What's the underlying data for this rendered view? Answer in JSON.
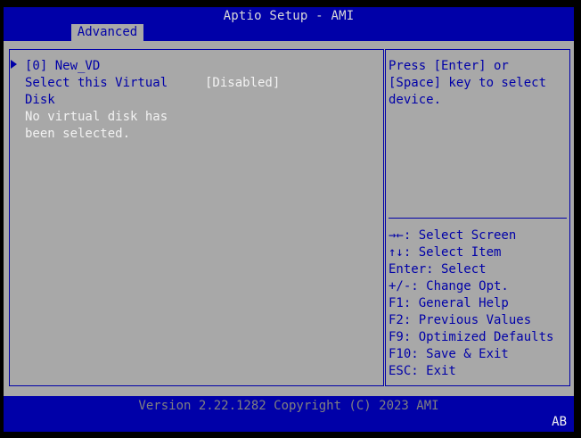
{
  "header": {
    "title": "Aptio Setup - AMI",
    "tabs": [
      {
        "label": "Advanced"
      }
    ]
  },
  "menu": {
    "submenu_item": "[0] New_VD",
    "option": {
      "label_line1": "Select this Virtual",
      "label_line2": "Disk",
      "value": "[Disabled]"
    },
    "info_line1": "No virtual disk has",
    "info_line2": "been selected."
  },
  "help": {
    "description_lines": [
      "Press [Enter] or",
      "[Space] key to select",
      "device."
    ],
    "keys": [
      "→←: Select Screen",
      "↑↓: Select Item",
      "Enter: Select",
      "+/-: Change Opt.",
      "F1: General Help",
      "F2: Previous Values",
      "F9: Optimized Defaults",
      "F10: Save & Exit",
      "ESC: Exit"
    ]
  },
  "footer": {
    "version": "Version 2.22.1282 Copyright (C) 2023 AMI",
    "keyboard_indicator": "AB"
  },
  "colors": {
    "bar_blue": "#0000a8",
    "panel_gray": "#a8a8a8",
    "highlight_white": "#f2f2f2",
    "screen_black": "#000000"
  }
}
